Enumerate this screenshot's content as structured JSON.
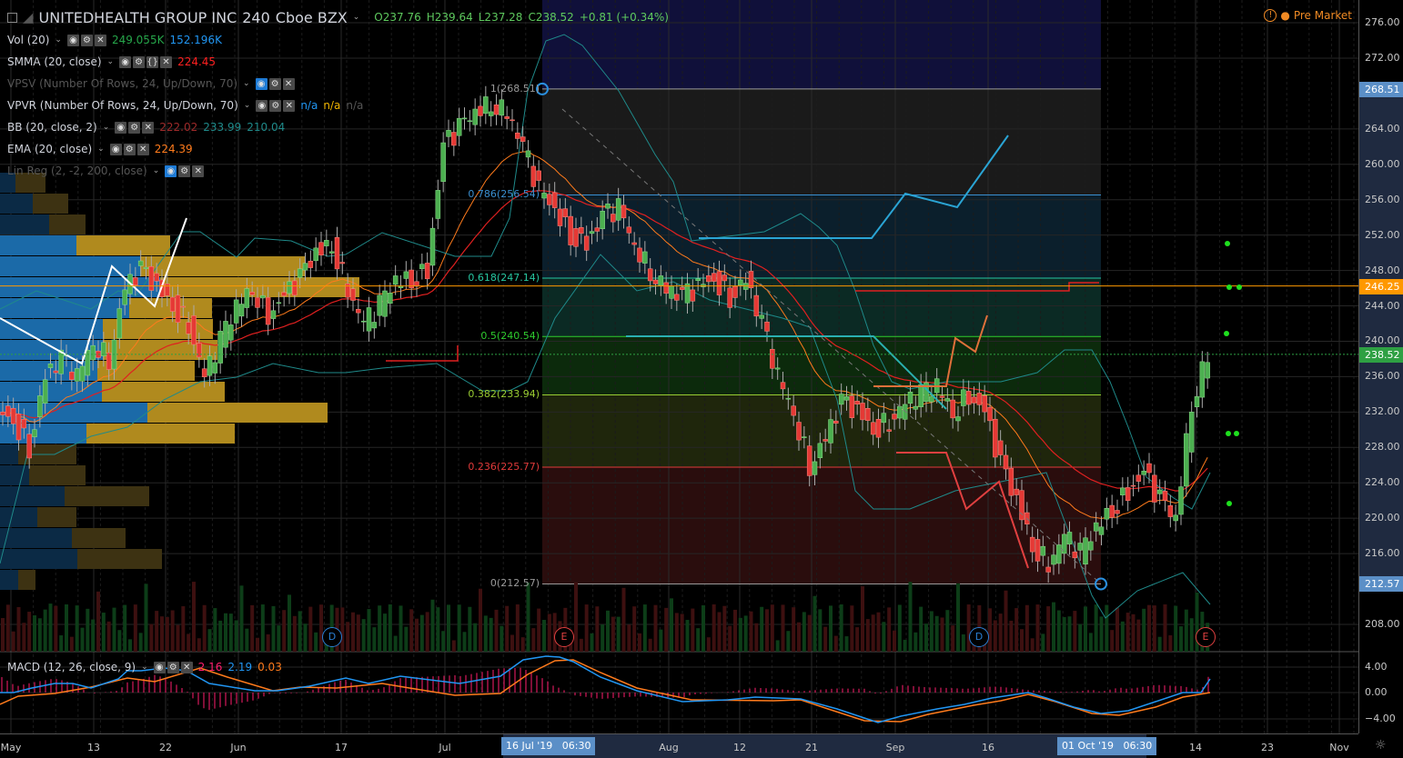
{
  "header": {
    "symbol": "UNITEDHEALTH GROUP INC",
    "interval": "240",
    "exchange": "Cboe BZX",
    "open": "O237.76",
    "high": "H239.64",
    "low": "L237.28",
    "close": "C238.52",
    "change": "+0.81 (+0.34%)",
    "market_status": "Pre Market"
  },
  "indicators": [
    {
      "name": "Vol (20)",
      "values": [
        {
          "v": "249.055K",
          "c": "#26a64a"
        },
        {
          "v": "152.196K",
          "c": "#2196f3"
        }
      ],
      "dim": false,
      "icons": [
        "eye",
        "gear",
        "close"
      ]
    },
    {
      "name": "SMMA (20, close)",
      "values": [
        {
          "v": "224.45",
          "c": "#ff2020"
        }
      ],
      "dim": false,
      "icons": [
        "eye",
        "gear",
        "braces",
        "close"
      ]
    },
    {
      "name": "VPSV (Number Of Rows, 24, Up/Down, 70)",
      "values": [],
      "dim": true,
      "icons": [
        "eye-off",
        "gear",
        "close"
      ]
    },
    {
      "name": "VPVR (Number Of Rows, 24, Up/Down, 70)",
      "values": [
        {
          "v": "n/a",
          "c": "#2196f3"
        },
        {
          "v": "n/a",
          "c": "#f0b400"
        },
        {
          "v": "n/a",
          "c": "#555"
        }
      ],
      "dim": false,
      "icons": [
        "eye",
        "gear",
        "close"
      ]
    },
    {
      "name": "BB (20, close, 2)",
      "values": [
        {
          "v": "222.02",
          "c": "#9e2a2a"
        },
        {
          "v": "233.99",
          "c": "#1f8a8a"
        },
        {
          "v": "210.04",
          "c": "#1f8a8a"
        }
      ],
      "dim": false,
      "icons": [
        "eye",
        "gear",
        "close"
      ]
    },
    {
      "name": "EMA (20, close)",
      "values": [
        {
          "v": "224.39",
          "c": "#ff7b1c"
        }
      ],
      "dim": false,
      "icons": [
        "eye",
        "gear",
        "close"
      ]
    },
    {
      "name": "Lin Reg (2, -2, 200, close)",
      "values": [],
      "dim": true,
      "icons": [
        "eye-off",
        "gear",
        "close"
      ]
    }
  ],
  "macd": {
    "name": "MACD (12, 26, close, 9)",
    "values": [
      {
        "v": "2.16",
        "c": "#ff1e6e"
      },
      {
        "v": "2.19",
        "c": "#2196f3"
      },
      {
        "v": "0.03",
        "c": "#ff7b1c"
      }
    ],
    "ticks": [
      "4.00",
      "0.00",
      "−4.00"
    ]
  },
  "price_axis": {
    "ticks": [
      "276.00",
      "272.00",
      "264.00",
      "260.00",
      "256.00",
      "252.00",
      "248.00",
      "244.00",
      "240.00",
      "236.00",
      "232.00",
      "228.00",
      "224.00",
      "220.00",
      "216.00",
      "208.00"
    ],
    "tick_values": [
      276,
      272,
      264,
      260,
      256,
      252,
      248,
      244,
      240,
      236,
      232,
      228,
      224,
      220,
      216,
      208
    ],
    "badges": [
      {
        "label": "268.51",
        "value": 268.51,
        "color": "#5b8fc7"
      },
      {
        "label": "246.25",
        "value": 246.25,
        "color": "#ff9800"
      },
      {
        "label": "238.52",
        "value": 238.52,
        "color": "#2ea043"
      },
      {
        "label": "212.57",
        "value": 212.57,
        "color": "#5b8fc7"
      }
    ]
  },
  "time_axis": {
    "labels": [
      "May",
      "13",
      "22",
      "Jun",
      "17",
      "Jul",
      "Aug",
      "12",
      "21",
      "Sep",
      "16",
      "14",
      "23",
      "Nov"
    ],
    "range_start": "16 Jul '19   06:30",
    "range_end": "01 Oct '19   06:30"
  },
  "fib": {
    "levels": [
      {
        "label": "1(268.51)",
        "price": 268.51,
        "color": "#9a9a9a"
      },
      {
        "label": "0.786(256.54)",
        "price": 256.54,
        "color": "#3a8fd0"
      },
      {
        "label": "0.618(247.14)",
        "price": 247.14,
        "color": "#26c6a0"
      },
      {
        "label": "0.5(240.54)",
        "price": 240.54,
        "color": "#2ecc2e"
      },
      {
        "label": "0.382(233.94)",
        "price": 233.94,
        "color": "#9acd32"
      },
      {
        "label": "0.236(225.77)",
        "price": 225.77,
        "color": "#e03a3a"
      },
      {
        "label": "0(212.57)",
        "price": 212.57,
        "color": "#9a9a9a"
      }
    ]
  },
  "events": [
    {
      "label": "D",
      "color": "#2a7fd4"
    },
    {
      "label": "E",
      "color": "#e04040"
    },
    {
      "label": "D",
      "color": "#2a7fd4"
    },
    {
      "label": "E",
      "color": "#e04040"
    }
  ],
  "chart_data": {
    "type": "candlestick",
    "title": "UNITEDHEALTH GROUP INC, 240, Cboe BZX",
    "ylim": [
      206,
      278
    ],
    "closes": [
      232,
      231,
      228,
      236,
      238,
      236,
      240,
      238,
      246,
      248,
      246,
      244,
      242,
      236,
      240,
      244,
      246,
      243,
      245,
      247,
      250,
      251,
      246,
      242,
      244,
      247,
      247,
      248,
      262,
      264,
      266,
      267,
      266,
      262,
      257,
      255,
      252,
      251,
      254,
      255,
      251,
      248,
      246,
      245,
      246,
      247,
      245,
      247,
      242,
      236,
      232,
      226,
      229,
      233,
      232,
      230,
      231,
      233,
      234,
      235,
      232,
      234,
      232,
      226,
      222,
      217,
      215,
      218,
      216,
      219,
      221,
      223,
      225,
      222,
      220,
      233,
      238.52
    ],
    "volume_profile_rows": [
      [
        17,
        50
      ],
      [
        36,
        75
      ],
      [
        54,
        94
      ],
      [
        84,
        187
      ],
      [
        154,
        336
      ],
      [
        176,
        395
      ],
      [
        142,
        233
      ],
      [
        113,
        234
      ],
      [
        113,
        239
      ],
      [
        107,
        214
      ],
      [
        112,
        247
      ],
      [
        162,
        360
      ],
      [
        95,
        258
      ],
      [
        20,
        84
      ],
      [
        32,
        94
      ],
      [
        71,
        164
      ],
      [
        41,
        84
      ],
      [
        79,
        138
      ],
      [
        85,
        178
      ],
      [
        20,
        39
      ]
    ]
  }
}
